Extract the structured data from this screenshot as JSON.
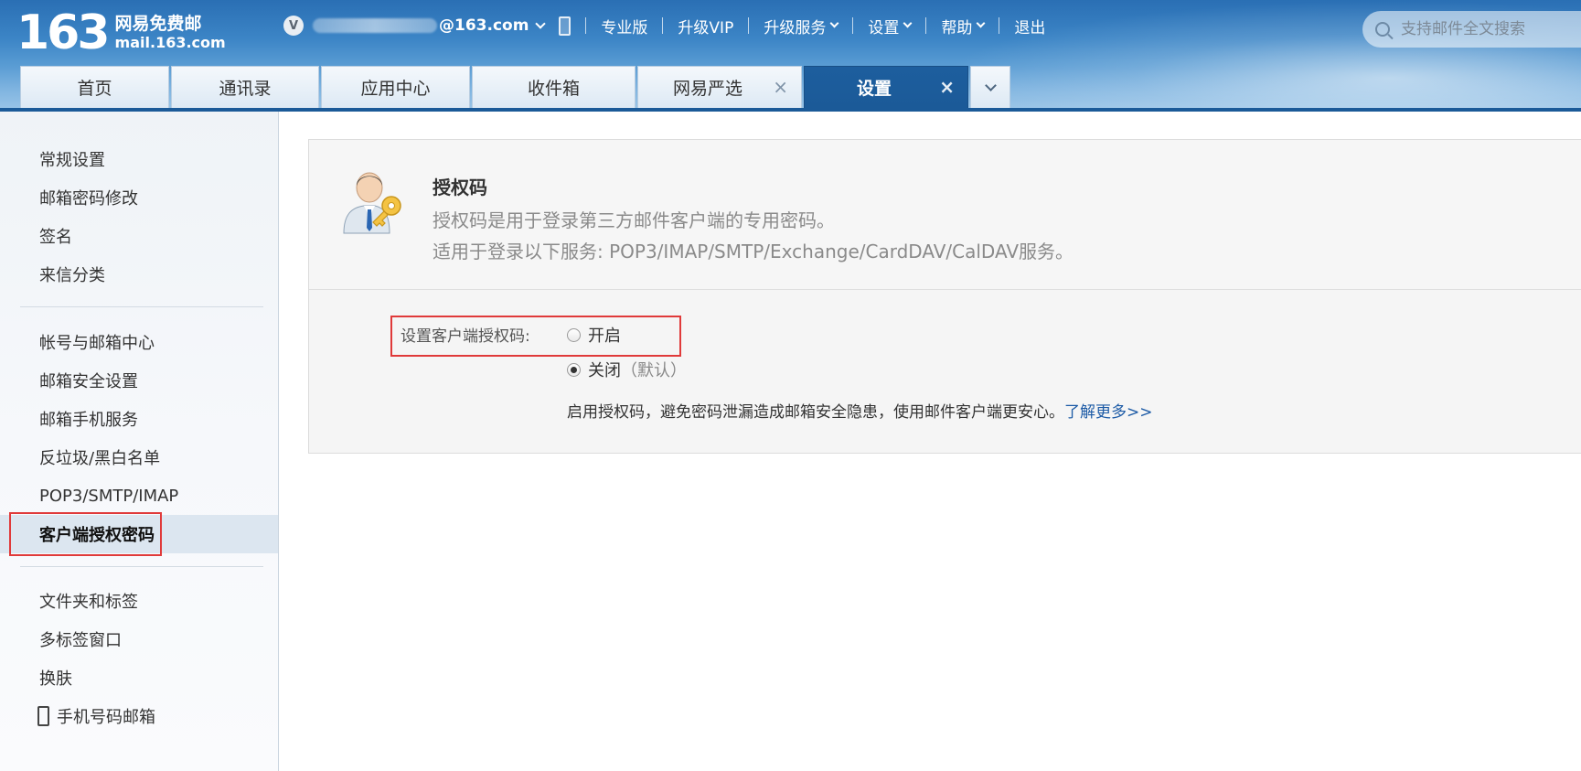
{
  "header": {
    "logo_number": "163",
    "logo_name": "网易免费邮",
    "logo_domain": "mail.163.com",
    "account_badge": "V",
    "account_email": "@163.com",
    "links": [
      "专业版",
      "升级VIP",
      "升级服务",
      "设置",
      "帮助",
      "退出"
    ],
    "search_placeholder": "支持邮件全文搜索"
  },
  "tabs": [
    {
      "label": "首页",
      "closable": false,
      "active": false
    },
    {
      "label": "通讯录",
      "closable": false,
      "active": false
    },
    {
      "label": "应用中心",
      "closable": false,
      "active": false
    },
    {
      "label": "收件箱",
      "closable": false,
      "active": false
    },
    {
      "label": "网易严选",
      "closable": true,
      "active": false
    },
    {
      "label": "设置",
      "closable": true,
      "active": true
    }
  ],
  "close_glyph": "×",
  "sidebar": {
    "group1": [
      "常规设置",
      "邮箱密码修改",
      "签名",
      "来信分类"
    ],
    "group2": [
      "帐号与邮箱中心",
      "邮箱安全设置",
      "邮箱手机服务",
      "反垃圾/黑白名单",
      "POP3/SMTP/IMAP",
      "客户端授权密码"
    ],
    "active_item": "客户端授权密码",
    "group3": [
      "文件夹和标签",
      "多标签窗口",
      "换肤",
      "手机号码邮箱"
    ]
  },
  "panel": {
    "title": "授权码",
    "desc1": "授权码是用于登录第三方邮件客户端的专用密码。",
    "desc2": "适用于登录以下服务: POP3/IMAP/SMTP/Exchange/CardDAV/CalDAV服务。",
    "option_label": "设置客户端授权码:",
    "option_on": "开启",
    "option_off": "关闭",
    "option_off_default": "（默认）",
    "selected": "关闭",
    "hint": "启用授权码，避免密码泄漏造成邮箱安全隐患，使用邮件客户端更安心。",
    "learn_more": "了解更多>>"
  },
  "colors": {
    "accent": "#1b5a98",
    "highlight": "#e03a3a",
    "link": "#1d5ba6"
  }
}
